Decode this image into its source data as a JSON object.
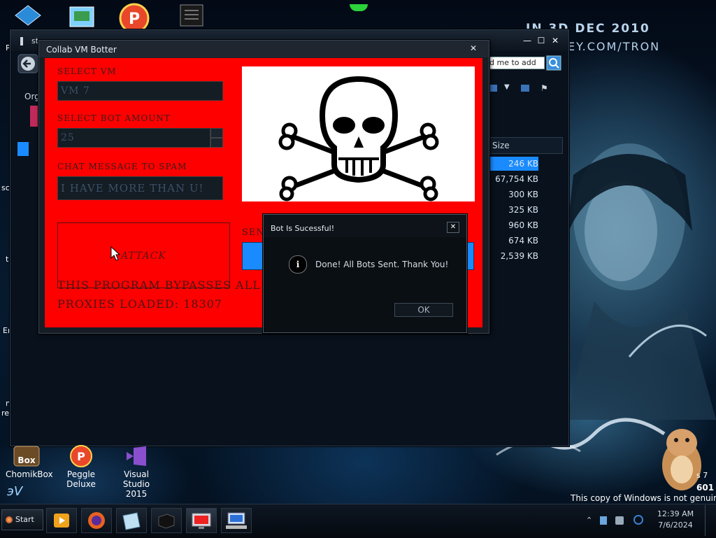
{
  "wallpaper": {
    "date_text": "IN 3D DEC 2010",
    "url_text": "EY.COM/TRON",
    "left_fragments": [
      "P",
      "Org",
      "sc",
      "t",
      "Er",
      "n",
      "re"
    ],
    "bottom_right_line1": "s 7",
    "bottom_right_line2": "601",
    "genuine_notice": "This copy of Windows is not genuine"
  },
  "explorer": {
    "title_fragment": "st",
    "search_text": "d me to add",
    "size_header": "Size",
    "file_sizes": [
      "246 KB",
      "67,754 KB",
      "300 KB",
      "325 KB",
      "960 KB",
      "674 KB",
      "2,539 KB"
    ],
    "selected_index": 0,
    "controls": {
      "minimize": "—",
      "maximize": "☐",
      "close": "✕"
    }
  },
  "collab": {
    "title": "Collab VM Botter",
    "close": "✕",
    "select_vm_label": "SELECT VM",
    "select_vm_value": "VM 7",
    "bot_amount_label": "SELECT BOT AMOUNT",
    "bot_amount_value": "25",
    "chat_label": "CHAT MESSAGE TO SPAM",
    "chat_value": "I HAVE MORE THAN U!",
    "attack_label": "ATTACK",
    "send_label_fragment": "SEN",
    "bypass_text": "THIS PROGRAM BYPASSES ALL WH",
    "proxies_text": "PROXIES LOADED: 18307",
    "image_icon": "skull-crossbones-icon"
  },
  "dialog": {
    "title": "Bot Is Sucessful!",
    "close": "✕",
    "message": "Done! All Bots Sent. Thank You!",
    "ok_label": "OK",
    "info_glyph": "i"
  },
  "desktop_icons": [
    {
      "label": "ChomikBox",
      "label2": "",
      "icon": "chomikbox-icon"
    },
    {
      "label": "Peggle",
      "label2": "Deluxe",
      "icon": "peggle-icon"
    },
    {
      "label": "Visual Studio",
      "label2": "2015",
      "icon": "visual-studio-icon"
    }
  ],
  "taskbar": {
    "start_label": "Start",
    "time": "12:39 AM",
    "date": "7/6/2024"
  },
  "colors": {
    "botter_red": "#ff0000",
    "selection_blue": "#1a8bff"
  }
}
